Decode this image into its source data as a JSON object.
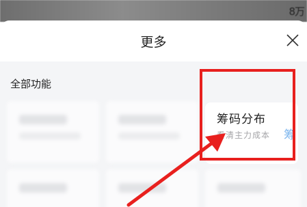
{
  "background": {
    "right_text": "8万"
  },
  "sheet": {
    "title": "更多",
    "section_label": "全部功能",
    "close_icon": "close-icon"
  },
  "feature_card": {
    "title": "筹码分布",
    "subtitle": "看清主力成本",
    "peek_text": "筹"
  },
  "annotation": {
    "color": "#e8201e"
  }
}
